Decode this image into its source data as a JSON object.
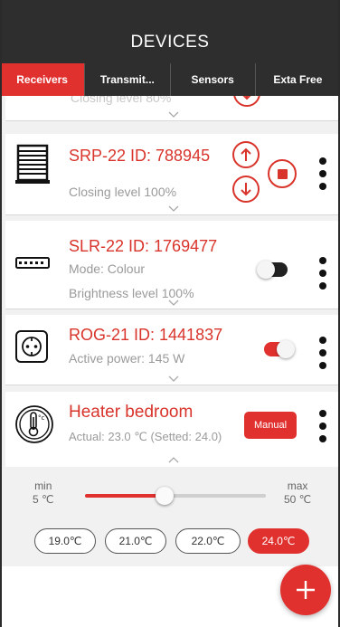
{
  "header": {
    "title": "DEVICES"
  },
  "tabs": [
    {
      "label": "Receivers",
      "active": true
    },
    {
      "label": "Transmit...",
      "active": false
    },
    {
      "label": "Sensors",
      "active": false
    },
    {
      "label": "Exta Free",
      "active": false
    }
  ],
  "devices": {
    "partial_top": {
      "subtitle": "Closing level 80%"
    },
    "srp": {
      "title": "SRP-22 ID: 788945",
      "subtitle": "Closing level 100%",
      "icon": "roller-blind-icon"
    },
    "slr": {
      "title": "SLR-22 ID: 1769477",
      "line1": "Mode: Colour",
      "line2": "Brightness level 100%",
      "toggle_on": false,
      "icon": "led-strip-icon"
    },
    "rog": {
      "title": "ROG-21 ID: 1441837",
      "subtitle": "Active power: 145 W",
      "toggle_on": true,
      "icon": "socket-icon"
    },
    "heater": {
      "title": "Heater bedroom",
      "subtitle": "Actual: 23.0 ℃ (Setted: 24.0)",
      "mode_button": "Manual",
      "icon": "thermometer-icon"
    }
  },
  "heater_panel": {
    "min_label": "min",
    "min_value": "5 ℃",
    "max_label": "max",
    "max_value": "50 ℃",
    "slider_fraction": 0.44,
    "presets": [
      {
        "label": "19.0℃",
        "selected": false
      },
      {
        "label": "21.0℃",
        "selected": false
      },
      {
        "label": "22.0℃",
        "selected": false
      },
      {
        "label": "24.0℃",
        "selected": true
      }
    ]
  },
  "colors": {
    "accent": "#e0312f",
    "header": "#2e2e2e",
    "title_red": "#d9342b",
    "list_bg": "#f1f1f1"
  },
  "fab": {
    "icon": "plus-icon"
  }
}
